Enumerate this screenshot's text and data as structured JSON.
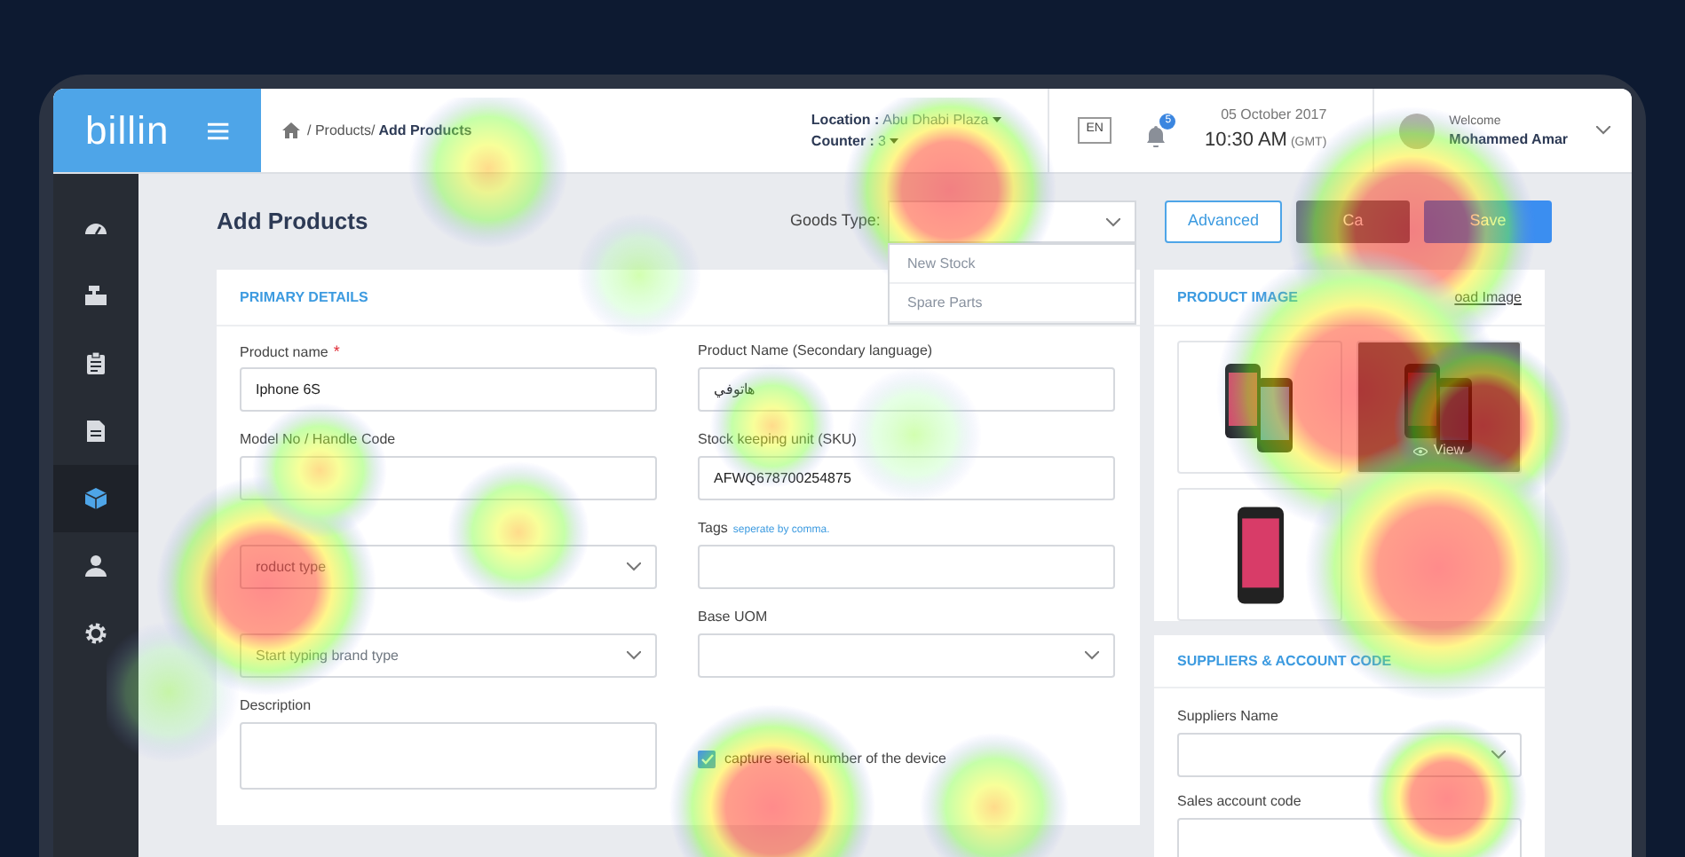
{
  "app": {
    "logo": "billin"
  },
  "breadcrumb": {
    "path": "/ Products/",
    "current": "Add Products"
  },
  "header": {
    "location_label": "Location :",
    "location": "Abu Dhabi Plaza",
    "counter_label": "Counter :",
    "counter": "3",
    "language": "EN",
    "notifications": "5",
    "date": "05 October 2017",
    "time": "10:30 AM",
    "timezone": "(GMT)",
    "welcome": "Welcome",
    "user": "Mohammed Amar"
  },
  "sidebar": {
    "items": [
      {
        "kind": "dashboard",
        "selected": false
      },
      {
        "kind": "register",
        "selected": false
      },
      {
        "kind": "clipboard",
        "selected": false
      },
      {
        "kind": "document",
        "selected": false
      },
      {
        "kind": "cube",
        "selected": true
      },
      {
        "kind": "user",
        "selected": false
      },
      {
        "kind": "gear",
        "selected": false
      }
    ]
  },
  "page": {
    "title": "Add Products",
    "goods_type": {
      "label": "Goods Type:",
      "expanded": true,
      "options": [
        "New Stock",
        "Spare Parts"
      ]
    },
    "buttons": [
      {
        "label": "Advanced",
        "kind": "outline"
      },
      {
        "label": "Ca",
        "kind": "secondary"
      },
      {
        "label": "Save",
        "kind": "primary"
      }
    ]
  },
  "primary_details": {
    "title": "PRIMARY DETAILS",
    "left": [
      {
        "kind": "text",
        "label": "Product name",
        "required_mark": "*",
        "value": "Iphone 6S"
      },
      {
        "kind": "text",
        "label": "Model No / Handle Code"
      },
      {
        "kind": "select",
        "placeholder": "roduct type"
      },
      {
        "kind": "select",
        "placeholder": "Start typing  brand type"
      },
      {
        "kind": "textarea",
        "label": "Description"
      }
    ],
    "right": [
      {
        "kind": "text",
        "label": "Product Name (Secondary language)",
        "value": "هاتوفي"
      },
      {
        "kind": "text",
        "label": "Stock keeping unit (SKU)",
        "value": "AFWQ678700254875"
      },
      {
        "kind": "text",
        "label": "Tags",
        "hint": "seperate by comma."
      },
      {
        "kind": "select",
        "label": "Base UOM"
      },
      {
        "kind": "checkbox",
        "label": "capture serial number of the device",
        "checked": true
      }
    ]
  },
  "product_image": {
    "title": "PRODUCT IMAGE",
    "link": "oad Image",
    "images": [
      {
        "kind": "phone-pair"
      },
      {
        "kind": "phone-pair",
        "view": "View"
      },
      {
        "kind": "phone"
      }
    ]
  },
  "suppliers": {
    "title": "SUPPLIERS & ACCOUNT CODE",
    "fields": [
      {
        "kind": "select",
        "label": "Suppliers Name"
      },
      {
        "kind": "text",
        "label": "Sales account code"
      }
    ]
  }
}
